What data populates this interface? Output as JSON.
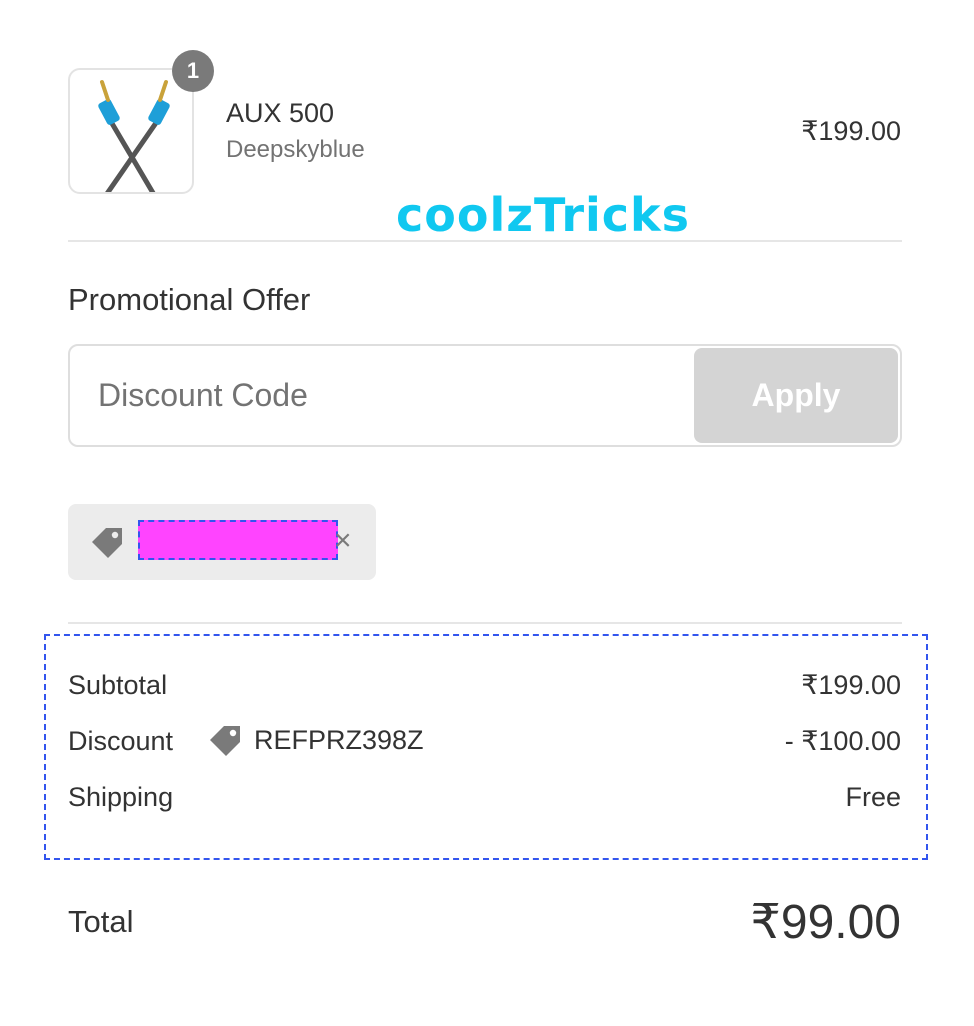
{
  "product": {
    "quantity": "1",
    "name": "AUX 500",
    "variant": "Deepskyblue",
    "price": "₹199.00"
  },
  "watermark": "coolzTricks",
  "promo": {
    "title": "Promotional Offer",
    "placeholder": "Discount Code",
    "apply_label": "Apply"
  },
  "applied_chip": {
    "close_glyph": "×"
  },
  "summary": {
    "subtotal_label": "Subtotal",
    "subtotal_value": "₹199.00",
    "discount_label": "Discount",
    "discount_code": "REFPRZ398Z",
    "discount_value": "- ₹100.00",
    "shipping_label": "Shipping",
    "shipping_value": "Free"
  },
  "total": {
    "label": "Total",
    "value": "₹99.00"
  },
  "colors": {
    "watermark": "#10c8f0",
    "apply_disabled": "#d4d4d4",
    "redaction": "#ff44ff",
    "highlight_border": "#3355ee"
  },
  "icons": {
    "product_image": "aux-cable-image",
    "tag": "price-tag-icon",
    "close": "close-icon"
  }
}
